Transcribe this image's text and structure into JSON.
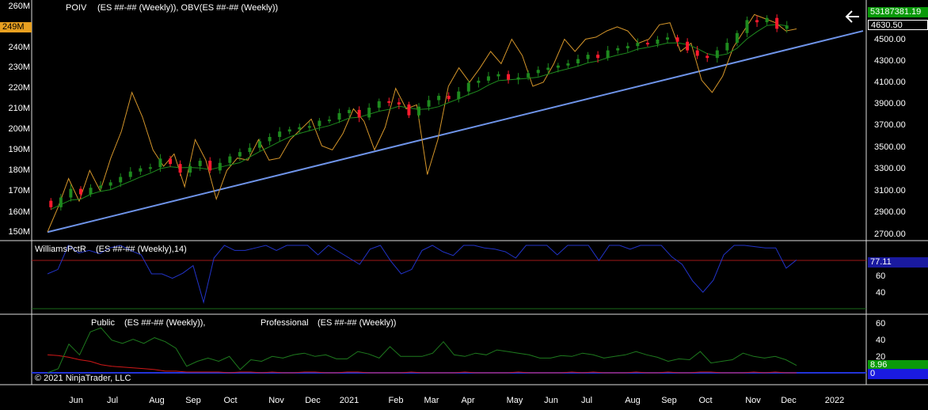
{
  "panel1": {
    "instrument_label": "POIV",
    "indicator_label": "(ES ##-## (Weekly)), OBV(ES ##-## (Weekly))",
    "left_axis": [
      "260M",
      "250M",
      "240M",
      "230M",
      "220M",
      "210M",
      "200M",
      "190M",
      "180M",
      "170M",
      "160M",
      "150M"
    ],
    "right_axis": [
      "4500.00",
      "4300.00",
      "4100.00",
      "3900.00",
      "3700.00",
      "3500.00",
      "3300.00",
      "3100.00",
      "2900.00",
      "2700.00"
    ],
    "left_marker": "249M",
    "obv_value": "53187381.19",
    "price_value": "4630.50"
  },
  "panel2": {
    "label": "WilliamsPctR",
    "params": "(ES ##-## (Weekly),14)",
    "right_axis": [
      "60",
      "40"
    ],
    "value": "77.11"
  },
  "panel3": {
    "public_label": "Public",
    "public_params": "(ES ##-## (Weekly)),",
    "professional_label": "Professional",
    "professional_params": "(ES ##-## (Weekly))",
    "right_axis": [
      "60",
      "40",
      "20"
    ],
    "green_value": "8.96",
    "blue_value": "0"
  },
  "copyright": "© 2021 NinjaTrader, LLC",
  "x_axis": [
    "Jun",
    "Jul",
    "Aug",
    "Sep",
    "Oct",
    "Nov",
    "Dec",
    "2021",
    "Feb",
    "Mar",
    "Apr",
    "May",
    "Jun",
    "Jul",
    "Aug",
    "Sep",
    "Oct",
    "Nov",
    "Dec",
    "2022"
  ],
  "colors": {
    "bull": "#1e8a1e",
    "bear": "#ff1a2e",
    "obv": "#d4952a",
    "trend": "#6e93e8",
    "wpr": "#2233c8",
    "pub": "#1e7a1e",
    "pro": "#d01818",
    "blue": "#2233d8",
    "ref_red": "#a01818",
    "ref_green": "#1a6a1a"
  },
  "chart_data": [
    {
      "type": "candlestick",
      "title": "",
      "series": [
        {
          "name": "ES ##-## (Weekly)",
          "close": [
            2950,
            3040,
            3120,
            3070,
            3130,
            3150,
            3180,
            3230,
            3280,
            3310,
            3320,
            3400,
            3350,
            3270,
            3330,
            3380,
            3290,
            3360,
            3420,
            3460,
            3500,
            3560,
            3600,
            3650,
            3670,
            3690,
            3700,
            3750,
            3760,
            3820,
            3850,
            3780,
            3870,
            3930,
            3920,
            3900,
            3800,
            3880,
            3940,
            3980,
            3950,
            4020,
            4100,
            4120,
            4160,
            4180,
            4130,
            4150,
            4190,
            4220,
            4240,
            4260,
            4280,
            4320,
            4360,
            4330,
            4400,
            4420,
            4440,
            4470,
            4460,
            4500,
            4520,
            4480,
            4400,
            4350,
            4330,
            4400,
            4470,
            4560,
            4680,
            4660,
            4700,
            4600,
            4630
          ]
        },
        {
          "name": "OBV",
          "values": [
            150,
            162,
            176,
            165,
            180,
            170,
            186,
            199,
            218,
            206,
            190,
            182,
            188,
            172,
            195,
            185,
            166,
            180,
            186,
            185,
            195,
            185,
            186,
            195,
            200,
            205,
            192,
            190,
            198,
            210,
            204,
            190,
            201,
            220,
            210,
            212,
            178,
            195,
            221,
            230,
            223,
            230,
            238,
            232,
            244,
            236,
            221,
            223,
            232,
            244,
            238,
            244,
            245,
            248,
            250,
            248,
            242,
            244,
            251,
            252,
            238,
            242,
            224,
            218,
            226,
            240,
            248,
            256,
            254,
            252,
            248,
            249
          ]
        },
        {
          "name": "Trendline",
          "values": [
            2720,
            4580
          ]
        }
      ]
    },
    {
      "type": "line",
      "title": "",
      "series": [
        {
          "name": "WilliamsPctR",
          "values": [
            55,
            62,
            100,
            88,
            92,
            87,
            96,
            100,
            92,
            85,
            55,
            55,
            48,
            56,
            68,
            10,
            80,
            100,
            92,
            92,
            96,
            100,
            92,
            100,
            100,
            100,
            85,
            100,
            90,
            80,
            70,
            94,
            100,
            75,
            55,
            62,
            92,
            100,
            90,
            84,
            100,
            100,
            96,
            94,
            90,
            80,
            100,
            100,
            100,
            85,
            100,
            100,
            100,
            76,
            100,
            100,
            94,
            100,
            100,
            100,
            82,
            70,
            44,
            26,
            45,
            85,
            100,
            100,
            98,
            96,
            96,
            64,
            77
          ]
        }
      ],
      "ylim": [
        0,
        100
      ]
    },
    {
      "type": "line",
      "title": "",
      "series": [
        {
          "name": "Public",
          "values": [
            0,
            5,
            35,
            22,
            50,
            55,
            40,
            36,
            41,
            36,
            43,
            38,
            30,
            8,
            14,
            18,
            14,
            20,
            4,
            16,
            14,
            20,
            18,
            22,
            24,
            20,
            22,
            17,
            17,
            26,
            23,
            18,
            32,
            20,
            20,
            20,
            24,
            38,
            22,
            20,
            24,
            22,
            28,
            26,
            24,
            22,
            18,
            18,
            21,
            20,
            24,
            22,
            18,
            20,
            22,
            26,
            22,
            19,
            14,
            17,
            16,
            26,
            12,
            14,
            16,
            24,
            20,
            18,
            20,
            16,
            9
          ]
        },
        {
          "name": "Professional",
          "values": [
            22,
            21,
            19,
            16,
            14,
            10,
            8,
            7,
            6,
            5,
            4,
            2,
            2,
            1,
            1,
            1,
            1,
            0,
            1,
            1,
            0,
            1,
            0,
            0,
            1,
            1,
            0,
            0,
            1,
            1,
            0,
            0,
            0,
            0,
            1,
            0,
            0,
            0,
            0,
            1,
            0,
            0,
            0,
            0,
            1,
            0,
            0,
            0,
            0,
            1,
            0,
            1,
            0,
            0,
            0,
            1,
            0,
            0,
            1,
            0,
            0,
            1,
            1,
            0,
            0,
            0,
            1,
            0,
            1,
            0,
            0
          ]
        }
      ],
      "ylim": [
        0,
        60
      ]
    }
  ]
}
